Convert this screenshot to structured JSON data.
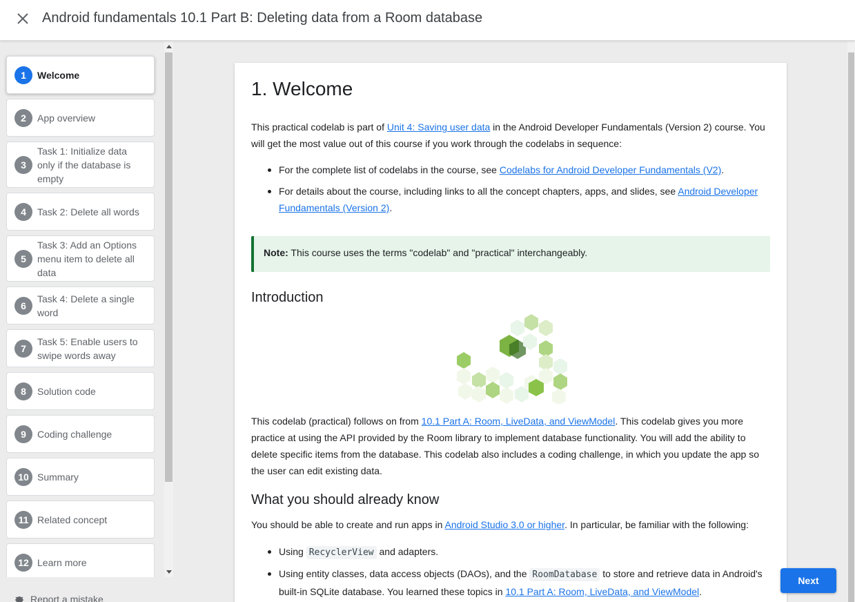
{
  "header": {
    "title": "Android fundamentals 10.1 Part B: Deleting data from a Room database"
  },
  "sidebar": {
    "steps": [
      {
        "num": "1",
        "label": "Welcome"
      },
      {
        "num": "2",
        "label": "App overview"
      },
      {
        "num": "3",
        "label": "Task 1: Initialize data only if the database is empty"
      },
      {
        "num": "4",
        "label": "Task 2: Delete all words"
      },
      {
        "num": "5",
        "label": "Task 3: Add an Options menu item to delete all data"
      },
      {
        "num": "6",
        "label": "Task 4: Delete a single word"
      },
      {
        "num": "7",
        "label": "Task 5: Enable users to swipe words away"
      },
      {
        "num": "8",
        "label": "Solution code"
      },
      {
        "num": "9",
        "label": "Coding challenge"
      },
      {
        "num": "10",
        "label": "Summary"
      },
      {
        "num": "11",
        "label": "Related concept"
      },
      {
        "num": "12",
        "label": "Learn more"
      }
    ],
    "report_label": "Report a mistake"
  },
  "content": {
    "title": "1. Welcome",
    "intro_pre": "This practical codelab is part of ",
    "intro_link": "Unit 4: Saving user data",
    "intro_post": " in the Android Developer Fundamentals (Version 2) course. You will get the most value out of this course if you work through the codelabs in sequence:",
    "bullet1_pre": "For the complete list of codelabs in the course, see ",
    "bullet1_link": "Codelabs for Android Developer Fundamentals (V2)",
    "bullet1_post": ".",
    "bullet2_pre": "For details about the course, including links to all the concept chapters, apps, and slides, see ",
    "bullet2_link": "Android Developer Fundamentals (Version 2)",
    "bullet2_post": ".",
    "note_label": "Note:",
    "note_text": " This course uses the terms \"codelab\" and \"practical\" interchangeably.",
    "intro_heading": "Introduction",
    "follow_pre": "This codelab (practical) follows on from ",
    "follow_link": "10.1 Part A: Room, LiveData, and ViewModel",
    "follow_post": ". This codelab gives you more practice at using the API provided by the Room library to implement database functionality. You will add the ability to delete specific items from the database. This codelab also includes a coding challenge, in which you update the app so the user can edit existing data.",
    "know_heading": "What you should already know",
    "know_pre": "You should be able to create and run apps in ",
    "know_link": "Android Studio 3.0 or higher",
    "know_post": ". In particular, be familiar with the following:",
    "kb1_pre": "Using ",
    "kb1_code": "RecyclerView",
    "kb1_post": " and adapters.",
    "kb2_pre": "Using entity classes, data access objects (DAOs), and the ",
    "kb2_code": "RoomDatabase",
    "kb2_mid": " to store and retrieve data in Android's built-in SQLite database. You learned these topics in ",
    "kb2_link": "10.1 Part A: Room, LiveData, and ViewModel",
    "kb2_post": "."
  },
  "footer": {
    "next_label": "Next"
  },
  "colors": {
    "accent": "#1a73e8",
    "note_bg": "#e6f4ea",
    "note_border": "#137333"
  }
}
